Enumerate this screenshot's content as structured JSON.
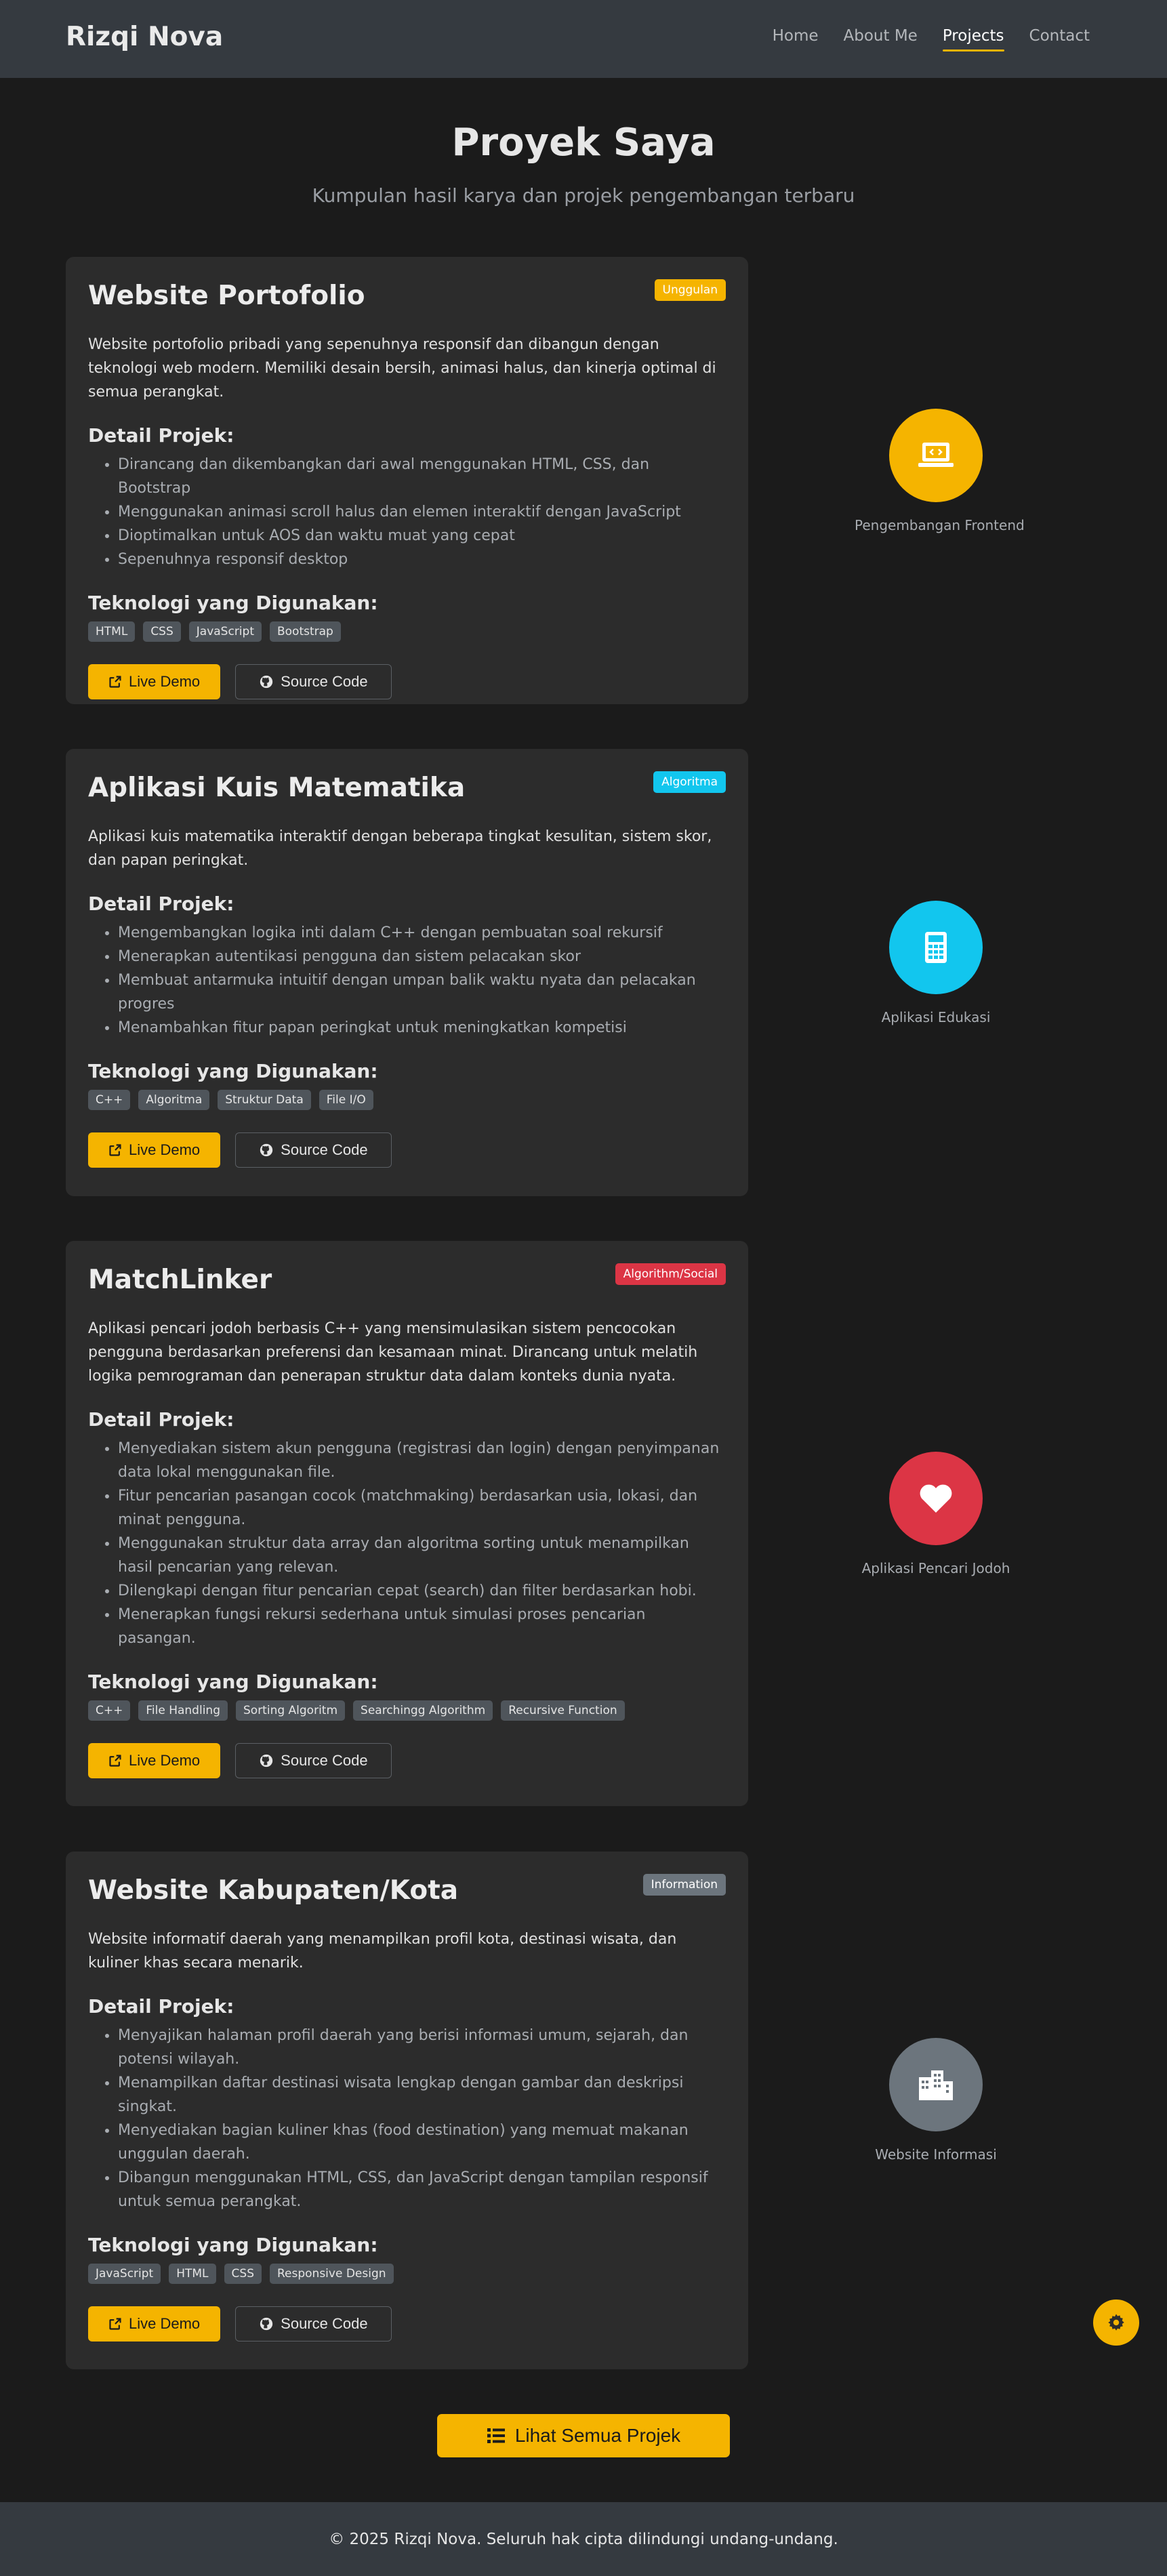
{
  "nav": {
    "brand": "Rizqi Nova",
    "links": [
      "Home",
      "About Me",
      "Projects",
      "Contact"
    ]
  },
  "header": {
    "title": "Proyek Saya",
    "subtitle": "Kumpulan hasil karya dan projek pengembangan terbaru"
  },
  "labels": {
    "detail_heading": "Detail Projek:",
    "tech_heading": "Teknologi yang Digunakan:",
    "live_demo": "Live Demo",
    "source_code": "Source Code",
    "all_projects": "Lihat Semua Projek"
  },
  "colors": {
    "accent": "#f5b400",
    "info": "#12c6ee",
    "danger": "#dc3545",
    "secondary": "#6c757d"
  },
  "projects": [
    {
      "title": "Website Portofolio",
      "badge": "Unggulan",
      "badge_color": "#f5b400",
      "description": "Website portofolio pribadi yang sepenuhnya responsif dan dibangun dengan teknologi web modern. Memiliki desain bersih, animasi halus, dan kinerja optimal di semua perangkat.",
      "details": [
        "Dirancang dan dikembangkan dari awal menggunakan HTML, CSS, dan Bootstrap",
        "Menggunakan animasi scroll halus dan elemen interaktif dengan JavaScript",
        "Dioptimalkan untuk AOS dan waktu muat yang cepat",
        "Sepenuhnya responsif desktop"
      ],
      "tech": [
        "HTML",
        "CSS",
        "JavaScript",
        "Bootstrap"
      ],
      "side_icon": "laptop-code-icon",
      "side_color": "#f5b400",
      "side_label": "Pengembangan Frontend"
    },
    {
      "title": "Aplikasi Kuis Matematika",
      "badge": "Algoritma",
      "badge_color": "#12c6ee",
      "description": "Aplikasi kuis matematika interaktif dengan beberapa tingkat kesulitan, sistem skor, dan papan peringkat.",
      "details": [
        "Mengembangkan logika inti dalam C++ dengan pembuatan soal rekursif",
        "Menerapkan autentikasi pengguna dan sistem pelacakan skor",
        "Membuat antarmuka intuitif dengan umpan balik waktu nyata dan pelacakan progres",
        "Menambahkan fitur papan peringkat untuk meningkatkan kompetisi"
      ],
      "tech": [
        "C++",
        "Algoritma",
        "Struktur Data",
        "File I/O"
      ],
      "side_icon": "calculator-icon",
      "side_color": "#12c6ee",
      "side_label": "Aplikasi Edukasi"
    },
    {
      "title": "MatchLinker",
      "badge": "Algorithm/Social",
      "badge_color": "#dc3545",
      "description": "Aplikasi pencari jodoh berbasis C++ yang mensimulasikan sistem pencocokan pengguna berdasarkan preferensi dan kesamaan minat. Dirancang untuk melatih logika pemrograman dan penerapan struktur data dalam konteks dunia nyata.",
      "details": [
        "Menyediakan sistem akun pengguna (registrasi dan login) dengan penyimpanan data lokal menggunakan file.",
        "Fitur pencarian pasangan cocok (matchmaking) berdasarkan usia, lokasi, dan minat pengguna.",
        "Menggunakan struktur data array dan algoritma sorting untuk menampilkan hasil pencarian yang relevan.",
        "Dilengkapi dengan fitur pencarian cepat (search) dan filter berdasarkan hobi.",
        "Menerapkan fungsi rekursi sederhana untuk simulasi proses pencarian pasangan."
      ],
      "tech": [
        "C++",
        "File Handling",
        "Sorting Algoritm",
        "Searchingg Algorithm",
        "Recursive Function"
      ],
      "side_icon": "heart-icon",
      "side_color": "#dc3545",
      "side_label": "Aplikasi Pencari Jodoh"
    },
    {
      "title": "Website Kabupaten/Kota",
      "badge": "Information",
      "badge_color": "#6c757d",
      "description": "Website informatif daerah yang menampilkan profil kota, destinasi wisata, dan kuliner khas secara menarik.",
      "details": [
        "Menyajikan halaman profil daerah yang berisi informasi umum, sejarah, dan potensi wilayah.",
        "Menampilkan daftar destinasi wisata lengkap dengan gambar dan deskripsi singkat.",
        "Menyediakan bagian kuliner khas (food destination) yang memuat makanan unggulan daerah.",
        "Dibangun menggunakan HTML, CSS, dan JavaScript dengan tampilan responsif untuk semua perangkat."
      ],
      "tech": [
        "JavaScript",
        "HTML",
        "CSS",
        "Responsive Design"
      ],
      "side_icon": "city-icon",
      "side_color": "#6c757d",
      "side_label": "Website Informasi"
    }
  ],
  "footer": {
    "text": "© 2025 Rizqi Nova. Seluruh hak cipta dilindungi undang-undang."
  }
}
